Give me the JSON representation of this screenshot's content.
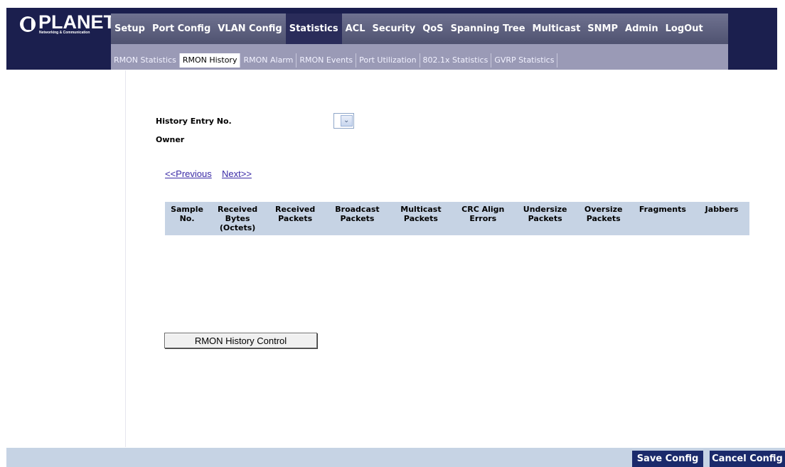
{
  "brand": {
    "name": "PLANET",
    "tagline": "Networking & Communication"
  },
  "top_nav": [
    {
      "label": "Setup"
    },
    {
      "label": "Port Config"
    },
    {
      "label": "VLAN Config"
    },
    {
      "label": "Statistics",
      "active": true
    },
    {
      "label": "ACL"
    },
    {
      "label": "Security"
    },
    {
      "label": "QoS"
    },
    {
      "label": "Spanning Tree"
    },
    {
      "label": "Multicast"
    },
    {
      "label": "SNMP"
    },
    {
      "label": "Admin"
    },
    {
      "label": "LogOut"
    }
  ],
  "sub_nav": [
    {
      "label": "RMON Statistics"
    },
    {
      "label": "RMON History",
      "active": true
    },
    {
      "label": "RMON Alarm"
    },
    {
      "label": "RMON Events"
    },
    {
      "label": "Port Utilization"
    },
    {
      "label": "802.1x Statistics"
    },
    {
      "label": "GVRP Statistics"
    }
  ],
  "form": {
    "history_entry_label": "History Entry No.",
    "history_entry_value": "",
    "owner_label": "Owner",
    "owner_value": ""
  },
  "pager": {
    "previous": "<<Previous",
    "next": "Next>>"
  },
  "table": {
    "headers": [
      [
        "Sample",
        "No."
      ],
      [
        "Received",
        "Bytes",
        "(Octets)"
      ],
      [
        "Received",
        "Packets"
      ],
      [
        "Broadcast",
        "Packets"
      ],
      [
        "Multicast",
        "Packets"
      ],
      [
        "CRC Align",
        "Errors"
      ],
      [
        "Undersize",
        "Packets"
      ],
      [
        "Oversize",
        "Packets"
      ],
      [
        "Fragments"
      ],
      [
        "Jabbers"
      ]
    ],
    "rows": []
  },
  "control_button": "RMON History Control",
  "footer": {
    "save": "Save Config",
    "cancel": "Cancel Config"
  },
  "colors": {
    "navy": "#1b1f4e",
    "table_header": "#c6d3e4",
    "footer_button": "#1b2a6b",
    "link": "#3a2aa6"
  }
}
